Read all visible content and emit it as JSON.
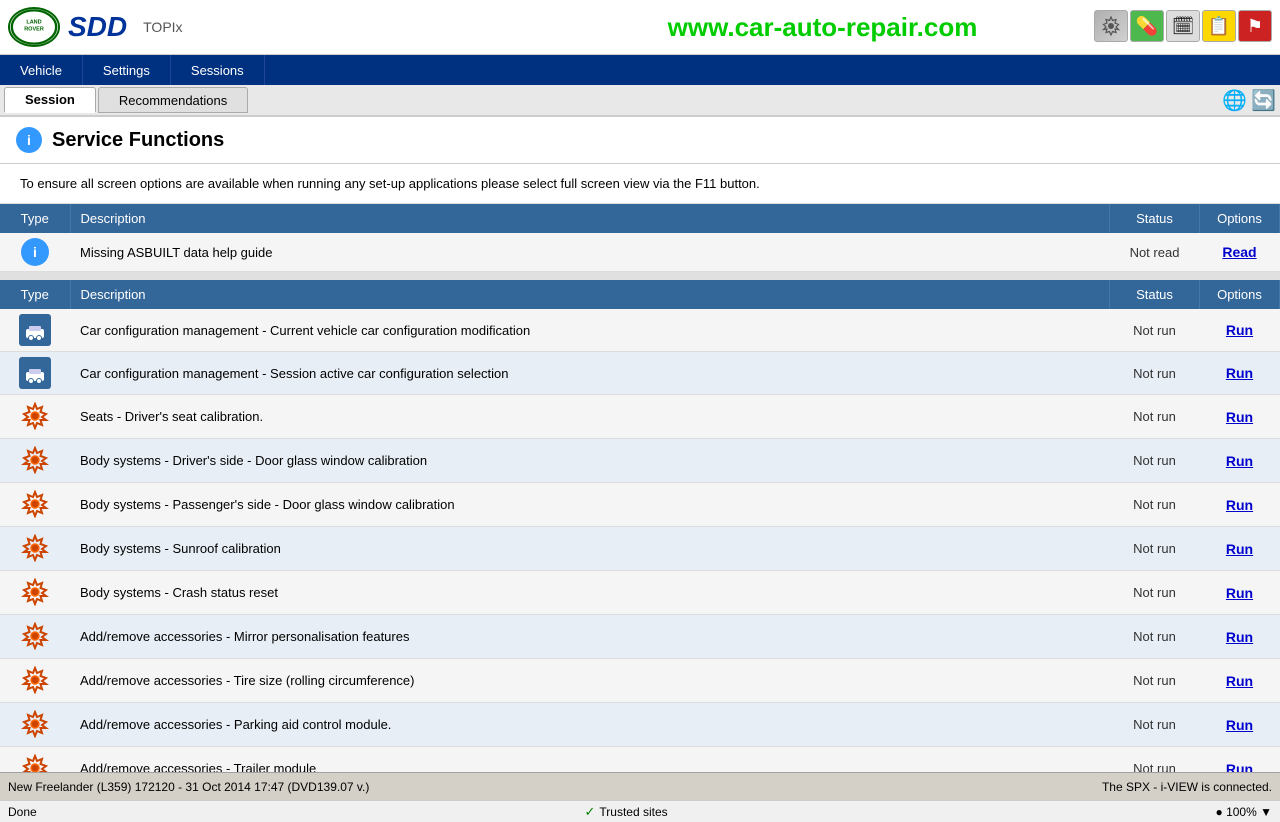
{
  "app": {
    "title": "SDD",
    "topix": "TOPIx",
    "website": "www.car-auto-repair.com",
    "land_rover_text": "LAND\nROVER"
  },
  "nav": {
    "tab_session": "Session",
    "tab_recommendations": "Recommendations"
  },
  "menu": {
    "vehicle": "Vehicle",
    "settings": "Settings",
    "sessions": "Sessions"
  },
  "page": {
    "title": "Service Functions",
    "info_message": "To ensure all screen options are available when running any set-up applications please select full screen view via the F11 button."
  },
  "recommendations_table": {
    "headers": [
      "Type",
      "Description",
      "Status",
      "Options"
    ],
    "rows": [
      {
        "type": "info",
        "description": "Missing ASBUILT data help guide",
        "status": "Not read",
        "option": "Read"
      }
    ]
  },
  "services_table": {
    "headers": [
      "Type",
      "Description",
      "Status",
      "Options"
    ],
    "rows": [
      {
        "type": "config",
        "description": "Car configuration management - Current vehicle car configuration modification",
        "status": "Not run",
        "option": "Run"
      },
      {
        "type": "config",
        "description": "Car configuration management - Session active car configuration selection",
        "status": "Not run",
        "option": "Run"
      },
      {
        "type": "gear",
        "description": "Seats - Driver's seat calibration.",
        "status": "Not run",
        "option": "Run"
      },
      {
        "type": "gear",
        "description": "Body systems - Driver's side - Door glass window calibration",
        "status": "Not run",
        "option": "Run"
      },
      {
        "type": "gear",
        "description": "Body systems - Passenger's side - Door glass window calibration",
        "status": "Not run",
        "option": "Run"
      },
      {
        "type": "gear",
        "description": "Body systems - Sunroof calibration",
        "status": "Not run",
        "option": "Run"
      },
      {
        "type": "gear",
        "description": "Body systems - Crash status reset",
        "status": "Not run",
        "option": "Run"
      },
      {
        "type": "gear",
        "description": "Add/remove accessories - Mirror personalisation features",
        "status": "Not run",
        "option": "Run"
      },
      {
        "type": "gear",
        "description": "Add/remove accessories - Tire size (rolling circumference)",
        "status": "Not run",
        "option": "Run"
      },
      {
        "type": "gear",
        "description": "Add/remove accessories - Parking aid control module.",
        "status": "Not run",
        "option": "Run"
      },
      {
        "type": "gear",
        "description": "Add/remove accessories - Trailer module",
        "status": "Not run",
        "option": "Run"
      }
    ]
  },
  "status_bar": {
    "left": "New Freelander (L359) 172120 - 31 Oct 2014 17:47 (DVD139.07 v.)",
    "right": "The SPX - i-VIEW is connected."
  },
  "bottom_bar": {
    "done": "Done",
    "trusted": "Trusted sites",
    "zoom": "● 100% ▼"
  }
}
